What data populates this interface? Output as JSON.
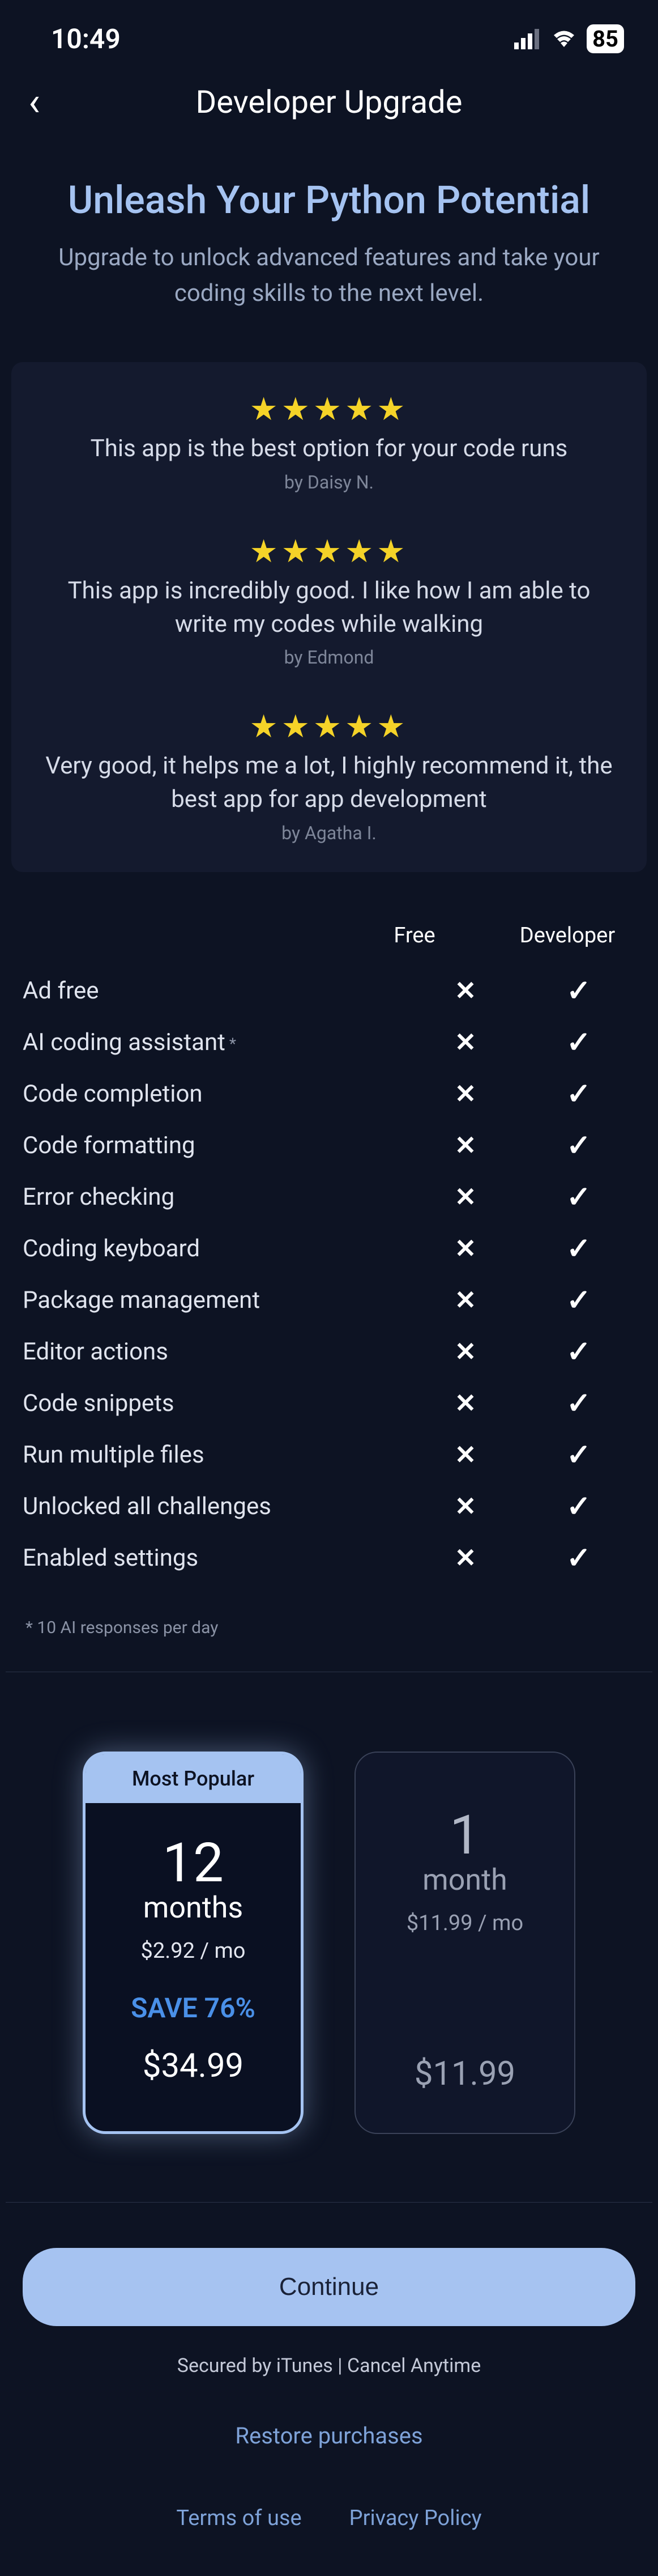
{
  "status": {
    "time": "10:49",
    "battery": "85"
  },
  "header": {
    "title": "Developer Upgrade"
  },
  "hero": {
    "title": "Unleash Your Python Potential",
    "subtitle": "Upgrade to unlock advanced features and take your coding skills to the next level."
  },
  "reviews": [
    {
      "stars": "★★★★★",
      "text": "This app is the best option for your code runs",
      "author": "by Daisy N."
    },
    {
      "stars": "★★★★★",
      "text": "This app is incredibly good. I like how I am able to write my codes while walking",
      "author": "by Edmond"
    },
    {
      "stars": "★★★★★",
      "text": "Very good, it helps me a lot, I highly recommend it, the best app for app development",
      "author": "by Agatha I."
    }
  ],
  "features": {
    "col1": "Free",
    "col2": "Developer",
    "rows": [
      {
        "label": "Ad free",
        "free": false,
        "dev": true
      },
      {
        "label": "AI coding assistant",
        "free": false,
        "dev": true,
        "note": true
      },
      {
        "label": "Code completion",
        "free": false,
        "dev": true
      },
      {
        "label": "Code formatting",
        "free": false,
        "dev": true
      },
      {
        "label": "Error checking",
        "free": false,
        "dev": true
      },
      {
        "label": "Coding keyboard",
        "free": false,
        "dev": true
      },
      {
        "label": "Package management",
        "free": false,
        "dev": true
      },
      {
        "label": "Editor actions",
        "free": false,
        "dev": true
      },
      {
        "label": "Code snippets",
        "free": false,
        "dev": true
      },
      {
        "label": "Run multiple files",
        "free": false,
        "dev": true
      },
      {
        "label": "Unlocked all challenges",
        "free": false,
        "dev": true
      },
      {
        "label": "Enabled settings",
        "free": false,
        "dev": true
      }
    ],
    "footnote": "* 10 AI responses per day"
  },
  "plans": {
    "popular": {
      "badge": "Most Popular",
      "num": "12",
      "period": "months",
      "rate": "$2.92 / mo",
      "save": "SAVE 76%",
      "price": "$34.99"
    },
    "monthly": {
      "num": "1",
      "period": "month",
      "rate": "$11.99 / mo",
      "price": "$11.99"
    }
  },
  "continue": "Continue",
  "secured": "Secured by iTunes | Cancel Anytime",
  "restore": "Restore purchases",
  "legal": {
    "terms": "Terms of use",
    "privacy": "Privacy Policy"
  }
}
